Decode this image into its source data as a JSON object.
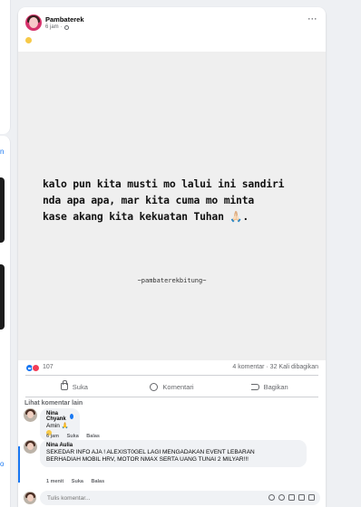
{
  "left_column": {
    "link_1": "n",
    "link_2": "o"
  },
  "post": {
    "author": "Pambaterek",
    "time": "6 jam",
    "image": {
      "quote": "kalo pun kita musti mo lalui ini sandiri\nnda apa apa, mar kita cuma mo minta\nkase akang kita kekuatan Tuhan 🙏🏻.",
      "watermark": "~pambaterekbitung~"
    },
    "stats": {
      "reactions": "107",
      "comments": "4 komentar",
      "shares": "32 Kali dibagikan"
    },
    "actions": {
      "like": "Suka",
      "comment": "Komentari",
      "share": "Bagikan"
    }
  },
  "comments": {
    "see_more": "Lihat komentar lain",
    "items": [
      {
        "name": "Nina Chyank",
        "text": "Amin 🙏",
        "time": "6 jam",
        "like": "Suka",
        "reply": "Balas"
      },
      {
        "name": "Nina Aulia",
        "text_line1": "SEKEDAR INFO AJA ! ALEXIST0GEL LAGI MENGADAKAN EVENT LEBARAN",
        "text_line2": "BERHADIAH MOBIL HRV, MOTOR NMAX SERTA UANG TUNAI 2 MILYAR!!!",
        "time": "1 menit",
        "like": "Suka",
        "reply": "Balas"
      }
    ]
  },
  "composer": {
    "placeholder": "Tulis komentar..."
  }
}
